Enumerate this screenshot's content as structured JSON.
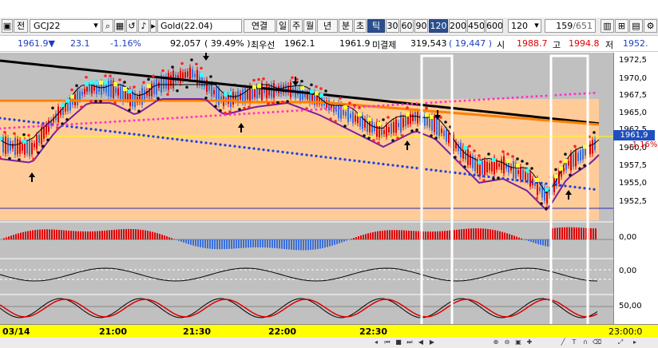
{
  "toolbar": {
    "side_label": "전",
    "symbol": "GCJ22",
    "name": "Gold(22.04)",
    "modes": [
      "연결",
      "일",
      "주",
      "월",
      "년",
      "분",
      "초",
      "틱"
    ],
    "intervals": [
      "30",
      "60",
      "90",
      "120",
      "200",
      "450",
      "600"
    ],
    "selected_interval": "120",
    "count_value": "120",
    "page": "159",
    "page_total": "/651"
  },
  "quote": {
    "price": "1961.9",
    "change": "23.1",
    "change_pct": "-1.16%",
    "volume": "92,057",
    "volume_ratio": "( 39.49% )",
    "bid_label": "최우선",
    "bid": "1962.1",
    "last": "1961.9",
    "open_interest_label": "미결제",
    "open_interest": "319,543",
    "oi_change": "( 19,447 )",
    "open_label": "시",
    "open": "1988.7",
    "high_label": "고",
    "high": "1994.8",
    "low_label": "저",
    "low": "1952."
  },
  "yaxis": {
    "price_ticks": [
      "1972,5",
      "1970,0",
      "1967,5",
      "1965,0",
      "1962,5",
      "1960,0",
      "1957,5",
      "1955,0",
      "1952,5"
    ],
    "current_tag": "1961,9",
    "current_pct": "-1.16%",
    "ind1": "0,00",
    "ind2": "0,00",
    "ind3": "50,00"
  },
  "xaxis": {
    "labels": [
      "03/14",
      "21:00",
      "21:30",
      "22:00",
      "22:30",
      "23:00:0"
    ]
  },
  "colors": {
    "plot_bg": "#c0c0c0",
    "price_fill": "#ffcc99",
    "axis_bar": "#ffff00",
    "up": "#e00000",
    "down": "#3b6fd8"
  }
}
